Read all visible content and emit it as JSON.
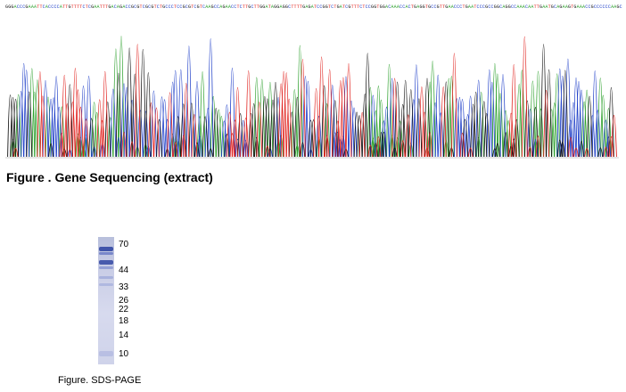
{
  "sequencing": {
    "caption": "Figure . Gene Sequencing (extract)",
    "sequence": "GGGACCCGAAATTCACCCCATTGTTTTCTCGAATTTGACAGACCGCGTCGCGTCTGCCCTCCGCGTCGTCAAGCCAGAACCTCTTGCTTGGATAGGAGGCTTTTGAGATCCGGTCTGATCGTTTCTCCGGTGGACAAACCACTGAGGTGCCGTTGAACCCTGAATCCCGCCGGCAGGCCAAACAATTGAATGCAGAAGTGAAACCGCCCCCCAAGCCCAACAGT",
    "colors": {
      "A": "#2ca02c",
      "C": "#1f3fc8",
      "G": "#111111",
      "T": "#e0201c"
    }
  },
  "gel": {
    "caption": "Figure. SDS-PAGE",
    "markers": [
      {
        "label": "70",
        "value": 70
      },
      {
        "label": "44",
        "value": 44
      },
      {
        "label": "33",
        "value": 33
      },
      {
        "label": "26",
        "value": 26
      },
      {
        "label": "22",
        "value": 22
      },
      {
        "label": "18",
        "value": 18
      },
      {
        "label": "14",
        "value": 14
      },
      {
        "label": "10",
        "value": 10
      }
    ],
    "band_color": "#3a4fa6"
  }
}
